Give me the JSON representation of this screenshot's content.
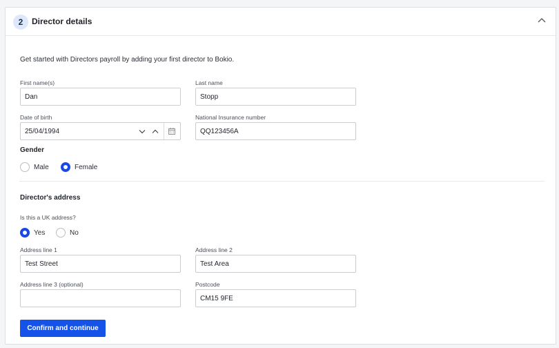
{
  "header": {
    "step_number": "2",
    "title": "Director details",
    "collapse_icon": "chevron-up-icon"
  },
  "intro_text": "Get started with Directors payroll by adding your first director to Bokio.",
  "fields": {
    "first_name": {
      "label": "First name(s)",
      "value": "Dan"
    },
    "last_name": {
      "label": "Last name",
      "value": "Stopp"
    },
    "date_of_birth": {
      "label": "Date of birth",
      "value": "25/04/1994"
    },
    "national_insurance": {
      "label": "National Insurance number",
      "value": "QQ123456A"
    }
  },
  "gender": {
    "label": "Gender",
    "options": [
      {
        "label": "Male",
        "selected": false
      },
      {
        "label": "Female",
        "selected": true
      }
    ]
  },
  "address": {
    "title": "Director's address",
    "uk_question": "Is this a UK address?",
    "uk_options": [
      {
        "label": "Yes",
        "selected": true
      },
      {
        "label": "No",
        "selected": false
      }
    ],
    "line1": {
      "label": "Address line 1",
      "value": "Test Street"
    },
    "line2": {
      "label": "Address line 2",
      "value": "Test Area"
    },
    "line3": {
      "label": "Address line 3 (optional)",
      "value": ""
    },
    "postcode": {
      "label": "Postcode",
      "value": "CM15 9FE"
    }
  },
  "confirm_button": "Confirm and continue",
  "colors": {
    "accent": "#1452e8",
    "step_circle_bg": "#dde9fb"
  }
}
